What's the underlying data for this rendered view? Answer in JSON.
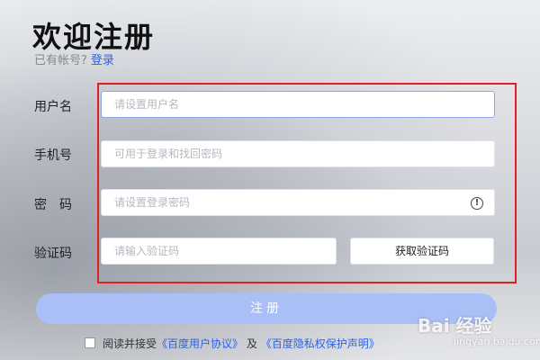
{
  "header": {
    "title": "欢迎注册",
    "have_account": "已有帐号?",
    "login_link": "登录"
  },
  "form": {
    "username": {
      "label": "用户名",
      "placeholder": "请设置用户名"
    },
    "phone": {
      "label": "手机号",
      "placeholder": "可用于登录和找回密码"
    },
    "password": {
      "label": "密　码",
      "placeholder": "请设置登录密码"
    },
    "code": {
      "label": "验证码",
      "placeholder": "请输入验证码",
      "button": "获取验证码"
    }
  },
  "submit_label": "注册",
  "agreement": {
    "prefix": "阅读并接受",
    "user_agreement": "《百度用户协议》",
    "and": "及",
    "privacy": "《百度隐私权保护声明》"
  },
  "watermark": "Bai 经验",
  "watermark_sub": "jingyan.baidu.com",
  "colors": {
    "accent": "#2f61e6",
    "submit_bg": "#a9bff5",
    "highlight": "#e02020"
  }
}
